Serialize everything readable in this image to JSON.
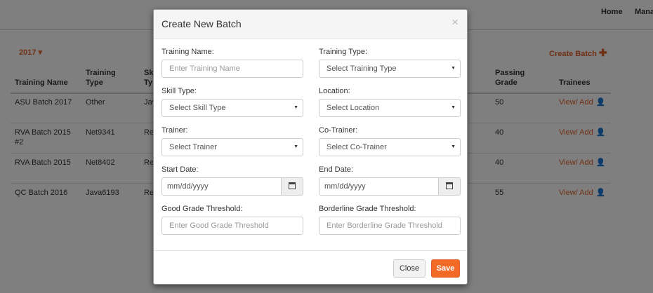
{
  "nav": {
    "home": "Home",
    "manage": "Mana"
  },
  "toolbar": {
    "year": "2017 ▾",
    "create_batch": "Create Batch",
    "create_batch_icon": "plus-icon"
  },
  "table": {
    "headers": {
      "training_name": "Training Name",
      "training_type_1": "Training",
      "training_type_2": "Type",
      "skill_1": "Sk",
      "skill_2": "Ty",
      "passing_1": "Passing",
      "passing_2": "Grade",
      "trainees": "Trainees"
    },
    "rows": [
      {
        "name": "ASU Batch 2017",
        "name2": "",
        "type": "Other",
        "skill": "Java",
        "passing": "50",
        "trainees": "View/ Add"
      },
      {
        "name": "RVA Batch 2015",
        "name2": "#2",
        "type": "Net9341",
        "skill": "Re",
        "passing": "40",
        "trainees": "View/ Add"
      },
      {
        "name": "RVA Batch 2015",
        "name2": "",
        "type": "Net8402",
        "skill": "Re",
        "passing": "40",
        "trainees": "View/ Add"
      },
      {
        "name": "QC Batch 2016",
        "name2": "",
        "type": "Java6193",
        "skill": "Re",
        "passing": "55",
        "trainees": "View/ Add"
      }
    ]
  },
  "modal": {
    "title": "Create New Batch",
    "close_glyph": "×",
    "fields": {
      "training_name": {
        "label": "Training Name:",
        "placeholder": "Enter Training Name"
      },
      "training_type": {
        "label": "Training Type:",
        "value": "Select Training Type"
      },
      "skill_type": {
        "label": "Skill Type:",
        "value": "Select Skill Type"
      },
      "location": {
        "label": "Location:",
        "value": "Select Location"
      },
      "trainer": {
        "label": "Trainer:",
        "value": "Select Trainer"
      },
      "co_trainer": {
        "label": "Co-Trainer:",
        "value": "Select Co-Trainer"
      },
      "start_date": {
        "label": "Start Date:",
        "value": "mm/dd/yyyy"
      },
      "end_date": {
        "label": "End Date:",
        "value": "mm/dd/yyyy"
      },
      "good_grade": {
        "label": "Good Grade Threshold:",
        "placeholder": "Enter Good Grade Threshold"
      },
      "borderline_grade": {
        "label": "Borderline Grade Threshold:",
        "placeholder": "Enter Borderline Grade Threshold"
      }
    },
    "buttons": {
      "close": "Close",
      "save": "Save"
    }
  },
  "colors": {
    "accent": "#f26a25",
    "link": "#e0612b"
  }
}
